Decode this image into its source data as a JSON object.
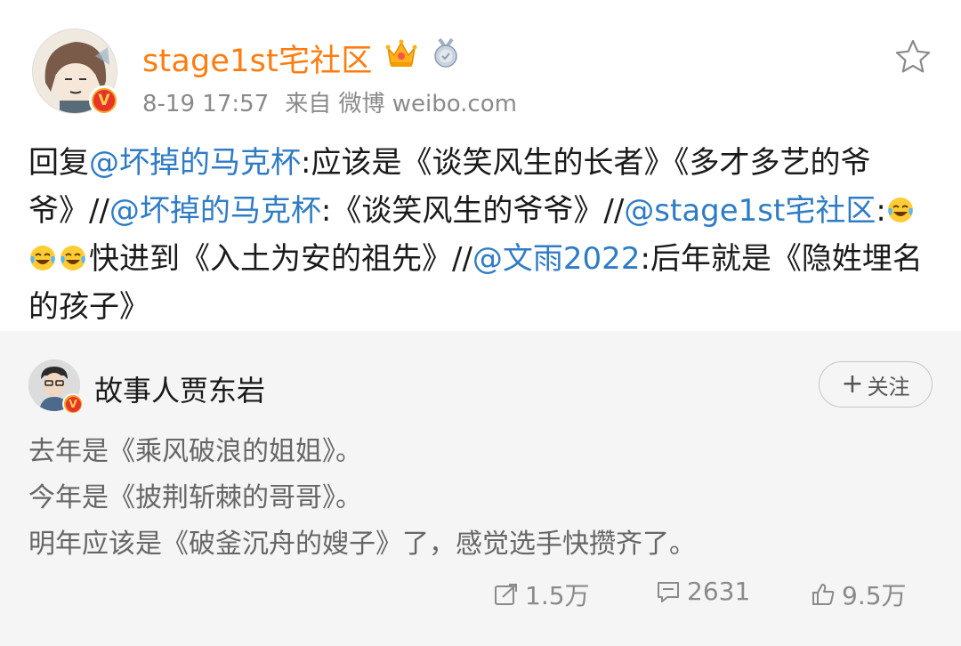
{
  "post": {
    "username": "stage1st宅社区",
    "time": "8-19 17:57",
    "source": "来自 微博 weibo.com",
    "text": {
      "reply_prefix": "回复",
      "mention1": "@坏掉的马克杯",
      "seg1": ":应该是《谈笑风生的长者》《多才多艺的爷爷》//",
      "mention2": "@坏掉的马克杯",
      "seg2": ":《谈笑风生的爷爷》//",
      "mention3": "@stage1st宅社区",
      "seg3": ":",
      "seg4": "快进到《入土为安的祖先》//",
      "mention4": "@文雨2022",
      "seg5": ":后年就是《隐姓埋名的孩子》"
    },
    "emoji_name": "laugh-cry-icon"
  },
  "repost": {
    "author": "故事人贾东岩",
    "follow_label": "关注",
    "lines": [
      "去年是《乘风破浪的姐姐》。",
      "今年是《披荆斩棘的哥哥》。",
      "明年应该是《破釜沉舟的嫂子》了，感觉选手快攒齐了。"
    ],
    "stats": {
      "reposts": "1.5万",
      "comments": "2631",
      "likes": "9.5万"
    }
  },
  "colors": {
    "username": "#ff7d10",
    "mention": "#2f7cc4",
    "meta": "#8a8a8a",
    "repost_bg": "#f5f5f5"
  }
}
